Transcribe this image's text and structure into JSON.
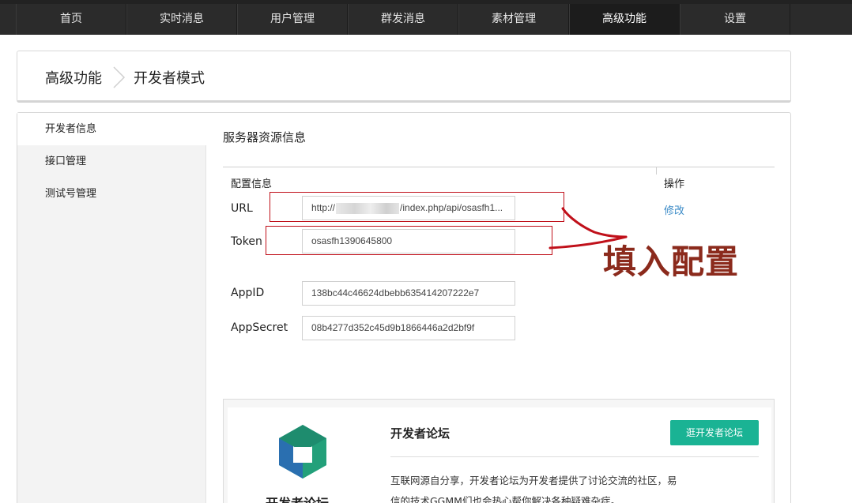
{
  "nav": {
    "items": [
      {
        "label": "首页"
      },
      {
        "label": "实时消息"
      },
      {
        "label": "用户管理"
      },
      {
        "label": "群发消息"
      },
      {
        "label": "素材管理"
      },
      {
        "label": "高级功能"
      },
      {
        "label": "设置"
      }
    ],
    "active_index": 5
  },
  "breadcrumb": {
    "parent": "高级功能",
    "current": "开发者模式"
  },
  "sidebar": {
    "items": [
      {
        "label": "开发者信息"
      },
      {
        "label": "接口管理"
      },
      {
        "label": "测试号管理"
      }
    ],
    "active_index": 0
  },
  "server": {
    "title": "服务器资源信息",
    "col_config": "配置信息",
    "col_op": "操作",
    "url_label": "URL",
    "url_prefix": "http://",
    "url_suffix": "/index.php/api/osasfh1...",
    "token_label": "Token",
    "token_value": "osasfh1390645800",
    "appid_label": "AppID",
    "appid_value": "138bc44c46624dbebb635414207222e7",
    "appsecret_label": "AppSecret",
    "appsecret_value": "08b4277d352c45d9b1866446a2d2bf9f",
    "edit_label": "修改"
  },
  "annotation": {
    "text": "填入配置",
    "color": "#8b2a1c"
  },
  "forum": {
    "logo_text": "开发者论坛",
    "title": "开发者论坛",
    "button_label": "逛开发者论坛",
    "description": "互联网源自分享，开发者论坛为开发者提供了讨论交流的社区，易信的技术GGMM们也会热心帮你解决各种疑难杂症。",
    "accent": "#1ab394"
  }
}
